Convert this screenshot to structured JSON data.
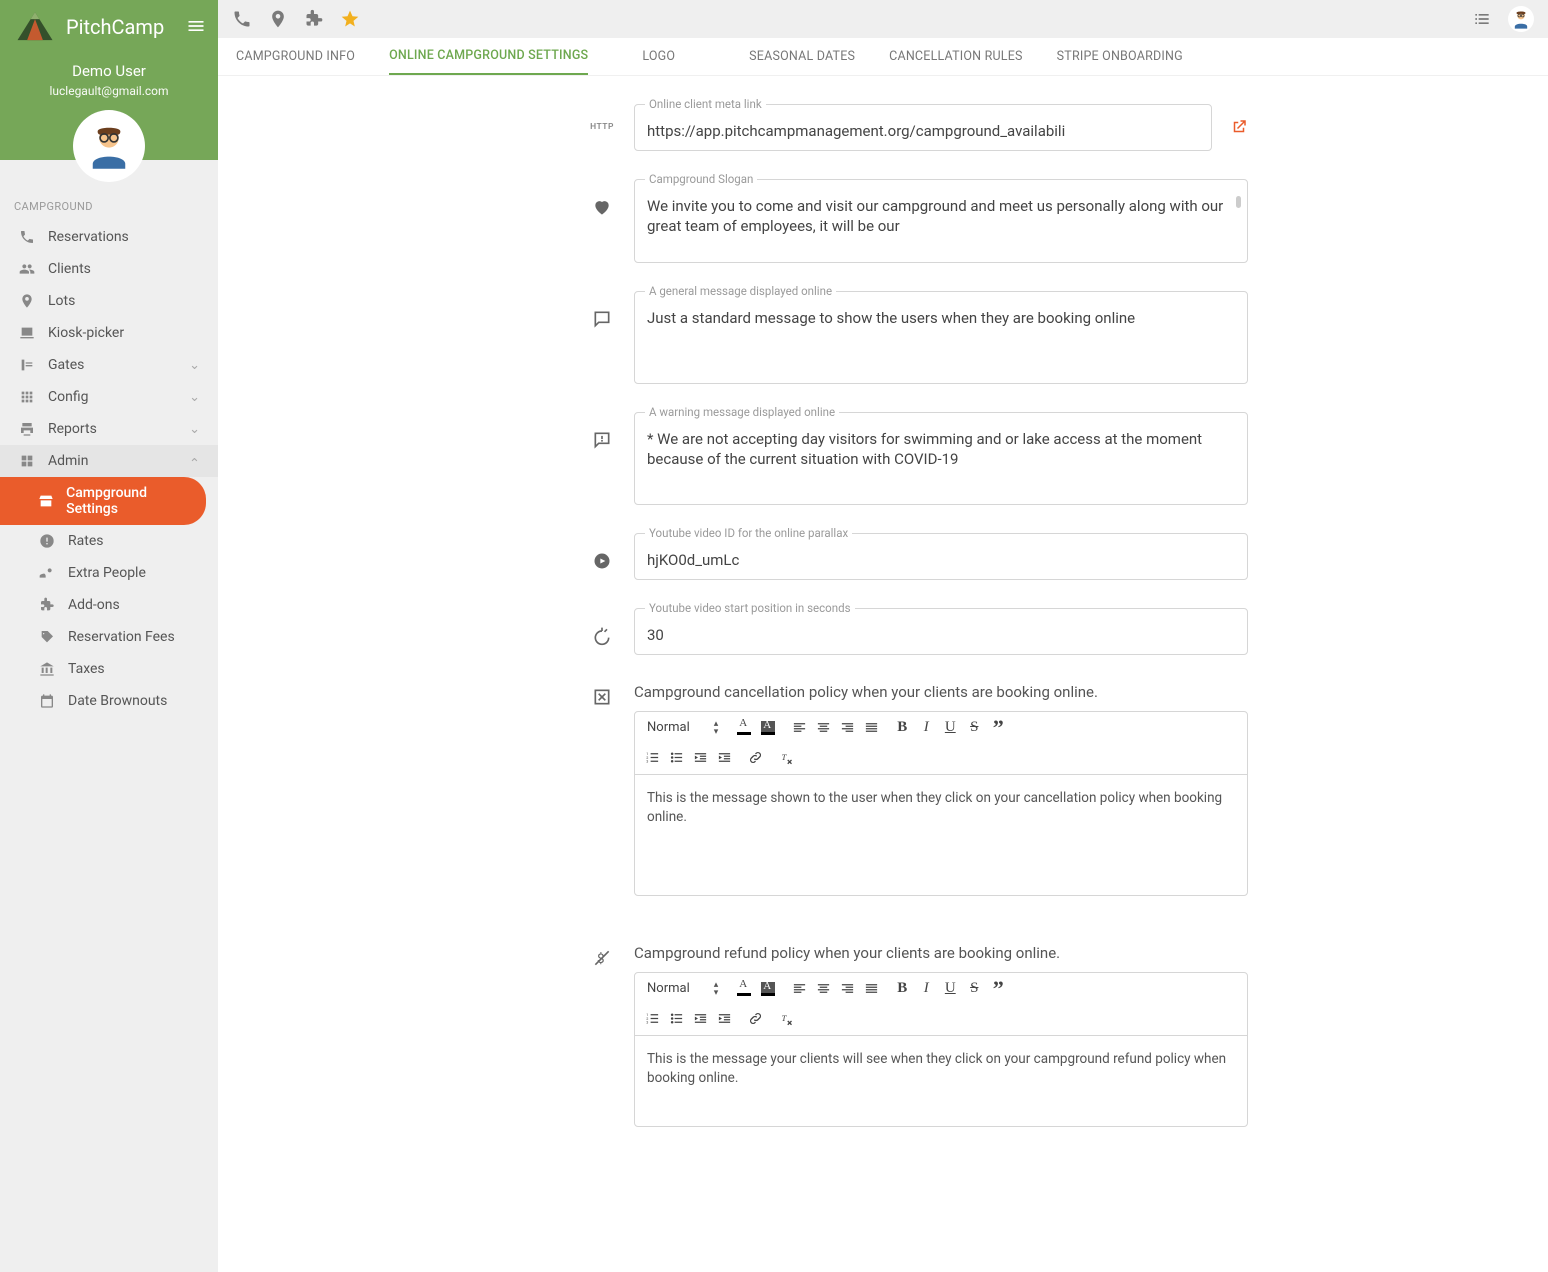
{
  "brand": {
    "name": "PitchCamp"
  },
  "user": {
    "name": "Demo User",
    "email": "luclegault@gmail.com"
  },
  "sidebar": {
    "section": "CAMPGROUND",
    "items": {
      "reservations": "Reservations",
      "clients": "Clients",
      "lots": "Lots",
      "kiosk": "Kiosk-picker",
      "gates": "Gates",
      "config": "Config",
      "reports": "Reports",
      "admin": "Admin"
    },
    "admin_sub": {
      "campground_settings": "Campground Settings",
      "rates": "Rates",
      "extra_people": "Extra People",
      "addons": "Add-ons",
      "reservation_fees": "Reservation Fees",
      "taxes": "Taxes",
      "date_brownouts": "Date Brownouts"
    }
  },
  "tabs": {
    "campground_info": "CAMPGROUND INFO",
    "online_settings": "ONLINE CAMPGROUND SETTINGS",
    "logo": "LOGO",
    "seasonal_dates": "SEASONAL DATES",
    "cancellation_rules": "CANCELLATION RULES",
    "stripe_onboarding": "STRIPE ONBOARDING"
  },
  "http_label": "HTTP",
  "fields": {
    "meta_link": {
      "label": "Online client meta link",
      "value": "https://app.pitchcampmanagement.org/campground_availabili"
    },
    "slogan": {
      "label": "Campground Slogan",
      "value": "We invite you to come and visit our campground and meet us personally along with our great team of employees, it will be our"
    },
    "general_msg": {
      "label": "A general message displayed online",
      "value": "Just a standard message to show the users when they are booking online"
    },
    "warning_msg": {
      "label": "A warning message displayed online",
      "value": "* We are not accepting day visitors for swimming and or lake access at the moment because of the current situation with COVID-19"
    },
    "yt_id": {
      "label": "Youtube video ID for the online parallax",
      "value": "hjKO0d_umLc"
    },
    "yt_start": {
      "label": "Youtube video start position in seconds",
      "value": "30"
    }
  },
  "policies": {
    "cancel": {
      "label": "Campground cancellation policy when your clients are booking online.",
      "body": "This is the message shown to the user when they click on your cancellation policy when booking online."
    },
    "refund": {
      "label": "Campground refund policy when your clients are booking online.",
      "body": "This is the message your clients will see when they click on your campground refund policy when booking online."
    }
  },
  "quill": {
    "normal": "Normal"
  }
}
